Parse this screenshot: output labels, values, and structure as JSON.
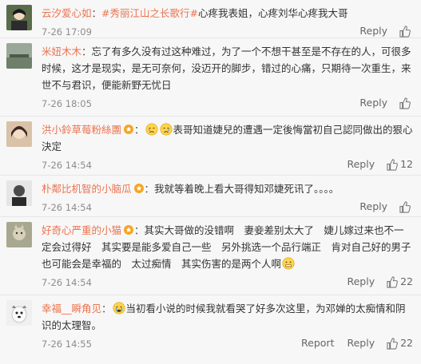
{
  "comments": [
    {
      "user": "云汐爱心如",
      "colon": "：",
      "topic": "#秀丽江山之长歌行#",
      "text": "心疼我表姐，心疼刘华心疼我大哥",
      "time": "7-26 17:09",
      "reply": "Reply",
      "likes": "",
      "avatar_color": "#5a6b4a"
    },
    {
      "user": "米妞木木",
      "colon": "：",
      "text": "忘了有多久没有过这种难过，为了一个不想干甚至是不存在的人，可很多时候，这才是现实，是无可奈何，没迈开的脚步，错过的心痛，只期待一次重生，来世不与君识，便能新野无忧日",
      "time": "7-26 18:05",
      "reply": "Reply",
      "likes": "",
      "avatar_color": "#6e7f6a"
    },
    {
      "user": "洪小鈴草莓粉絲團",
      "colon": "：",
      "text": "表哥知道婕兒的遭遇一定後悔當初自己認同做出的狠心決定",
      "time": "7-26 14:54",
      "reply": "Reply",
      "likes": "12",
      "avatar_color": "#b88a6a"
    },
    {
      "user": "朴鄰比机智的小脑瓜",
      "colon": "：",
      "text": "我就等着晚上看大哥得知邓婕死讯了。。。。",
      "time": "7-26 14:54",
      "reply": "Reply",
      "likes": "",
      "avatar_color": "#4a4a4a"
    },
    {
      "user": "好奇心严重的小猫",
      "colon": "：",
      "text": "其实大哥做的没错啊　妻妾差别太大了　婕儿嫁过来也不一定会过得好　其实要是能多爱自己一些　另外挑选一个品行端正　肯对自己好的男子　也可能会是幸福的　太过痴情　其实伤害的是两个人啊",
      "time": "7-26 14:54",
      "reply": "Reply",
      "likes": "22",
      "avatar_color": "#8a8a7a"
    },
    {
      "user": "幸福__瞬角见",
      "colon": "：",
      "text": "当初看小说的时候我就看哭了好多次这里，为邓婵的太痴情和阴识的太理智。",
      "time": "7-26 14:55",
      "report": "Report",
      "reply": "Reply",
      "likes": "22",
      "avatar_color": "#e8e8e8"
    }
  ],
  "colors": {
    "username": "#eb7350",
    "time": "#8c8c8c",
    "background": "#f7f7f7"
  },
  "icons": {
    "like": "thumbs-up-icon",
    "emoji_sad": "crying-face-emoji",
    "emoji_awkward": "grimace-face-emoji",
    "badge": "fan-badge-icon"
  }
}
